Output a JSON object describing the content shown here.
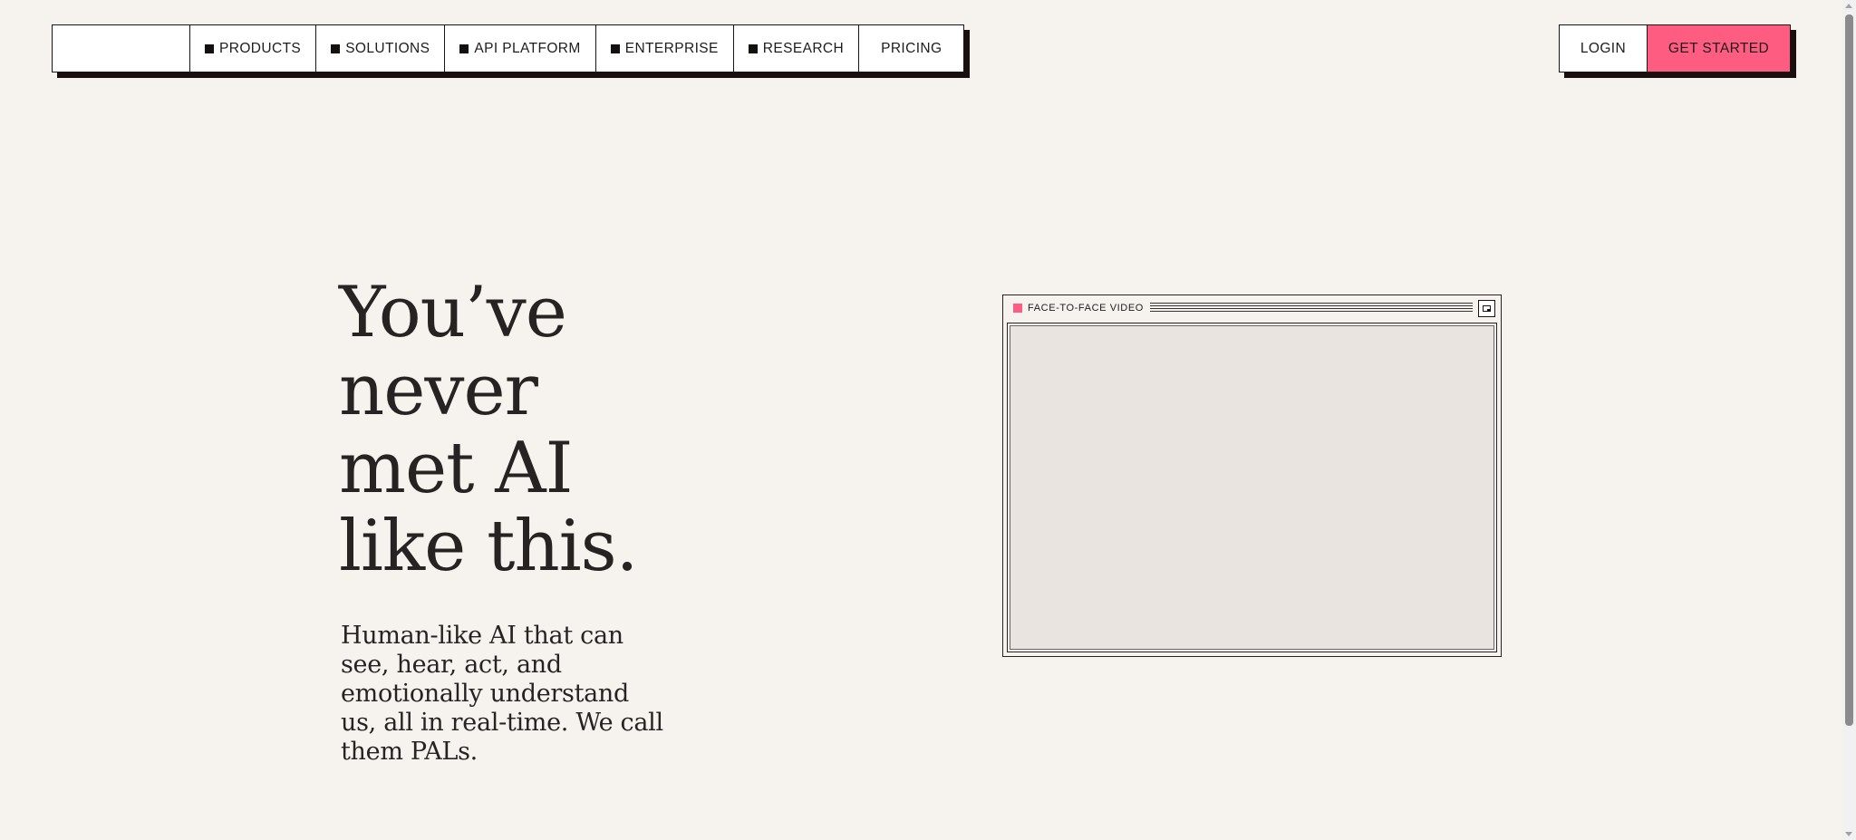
{
  "nav": {
    "items": [
      {
        "label": "PRODUCTS",
        "marker": true
      },
      {
        "label": "SOLUTIONS",
        "marker": true
      },
      {
        "label": "API PLATFORM",
        "marker": true
      },
      {
        "label": "ENTERPRISE",
        "marker": true
      },
      {
        "label": "RESEARCH",
        "marker": true
      },
      {
        "label": "PRICING",
        "marker": false
      }
    ],
    "login_label": "LOGIN",
    "get_started_label": "GET STARTED"
  },
  "hero": {
    "title_lines": [
      "You’ve",
      "never",
      "met AI",
      "like this."
    ],
    "subtitle": "Human-like AI that can see, hear, act, and emotionally understand us, all in real-time. We call them PALs."
  },
  "video": {
    "label": "FACE-TO-FACE VIDEO",
    "expand_icon": "expand-icon"
  },
  "colors": {
    "background": "#f6f3ef",
    "accent": "#fe5c80",
    "border": "#1a1414",
    "video_screen": "#e9e4df"
  }
}
